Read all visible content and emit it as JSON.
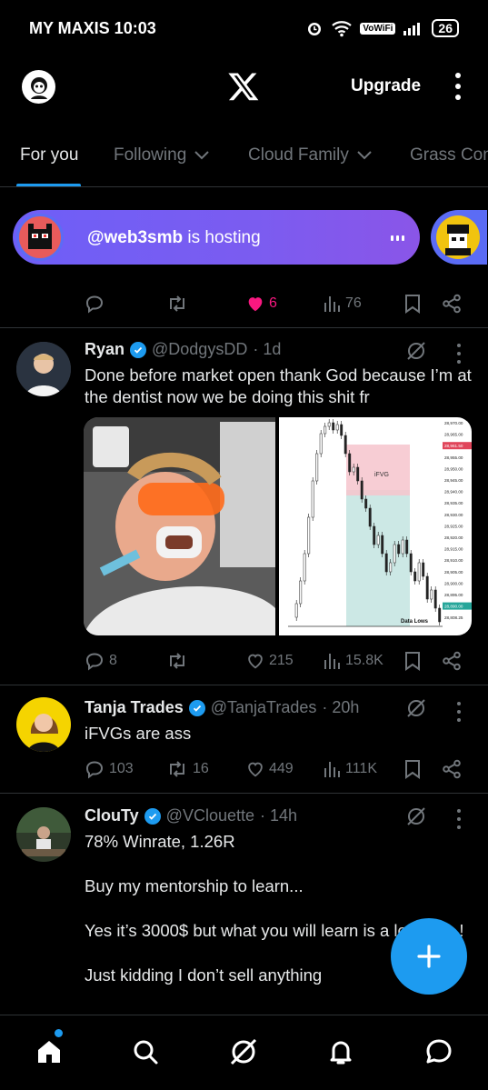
{
  "status": {
    "carrier_time": "MY MAXIS 10:03",
    "vowifi": "VoWiFi",
    "battery": "26"
  },
  "header": {
    "upgrade_label": "Upgrade"
  },
  "tabs": [
    {
      "label": "For you"
    },
    {
      "label": "Following"
    },
    {
      "label": "Cloud Family"
    },
    {
      "label": "Grass Con"
    }
  ],
  "spaces": {
    "host": "@web3smb",
    "suffix": "is hosting"
  },
  "prev_tweet": {
    "likes": "6",
    "views": "76"
  },
  "tweets": [
    {
      "name": "Ryan",
      "handle": "@DodgysDD",
      "time": "· 1d",
      "text": "Done before market open thank God because I’m at the dentist now we be doing this shit fr",
      "replies": "8",
      "retweets": "",
      "likes": "215",
      "views": "15.8K",
      "chart_labels": {
        "zone": "iFVG",
        "lows": "Data Lows"
      },
      "chart_prices": [
        "28,970.00",
        "28,965.00",
        "28,961.50",
        "28,955.00",
        "28,950.00",
        "28,945.00",
        "28,940.00",
        "28,935.00",
        "28,930.00",
        "28,925.00",
        "28,920.00",
        "28,915.00",
        "28,910.00",
        "28,905.00",
        "28,900.00",
        "28,895.00",
        "28,890.00",
        "28,808.25"
      ]
    },
    {
      "name": "Tanja Trades",
      "handle": "@TanjaTrades",
      "time": "· 20h",
      "text": "iFVGs are ass",
      "replies": "103",
      "retweets": "16",
      "likes": "449",
      "views": "111K"
    },
    {
      "name": "ClouTy",
      "handle": "@VClouette",
      "time": "· 14h",
      "paragraphs": [
        "78% Winrate, 1.26R",
        "Buy my mentorship to learn...",
        "Yes it’s 3000$ but what you will learn is a lot more !",
        "Just kidding I don’t sell anything"
      ]
    }
  ],
  "colors": {
    "accent": "#1d9bf0",
    "like": "#f91880",
    "muted": "#71767b",
    "space_purple": "#7b5cf0"
  }
}
